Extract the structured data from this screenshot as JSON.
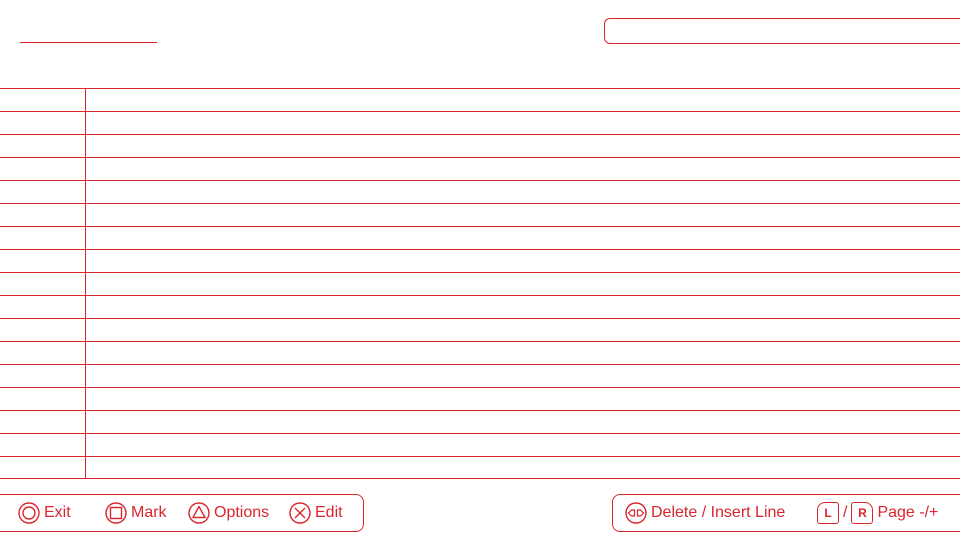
{
  "colors": {
    "accent": "#d9262d",
    "background": "#ffffff"
  },
  "footer": {
    "exit": {
      "label": "Exit",
      "icon": "circle-button-icon"
    },
    "mark": {
      "label": "Mark",
      "icon": "square-button-icon"
    },
    "options": {
      "label": "Options",
      "icon": "triangle-button-icon"
    },
    "edit": {
      "label": "Edit",
      "icon": "cross-button-icon"
    },
    "delete_insert": {
      "label": "Delete / Insert Line",
      "icon": "dpad-left-right-icon"
    },
    "page": {
      "l_key": "L",
      "separator": "/",
      "r_key": "R",
      "label": "Page -/+"
    }
  }
}
